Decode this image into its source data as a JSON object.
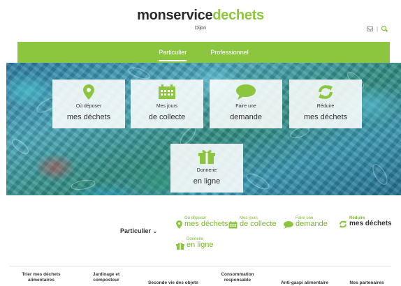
{
  "header": {
    "logo_part1": "monservice",
    "logo_part2": "dechets",
    "city": "Dijon",
    "separator": "|"
  },
  "nav": {
    "tabs": [
      {
        "label": "Particulier",
        "active": true
      },
      {
        "label": "Professionnel",
        "active": false
      }
    ]
  },
  "hero": {
    "tiles": [
      {
        "line1": "Où déposer",
        "line2": "mes déchets",
        "icon": "map-pin-icon"
      },
      {
        "line1": "Mes jours",
        "line2": "de collecte",
        "icon": "calendar-icon"
      },
      {
        "line1": "Faire une",
        "line2": "demande",
        "icon": "chat-bubble-icon"
      },
      {
        "line1": "Réduire",
        "line2": "mes déchets",
        "icon": "recycle-icon"
      },
      {
        "line1": "Donnerie",
        "line2": "en ligne",
        "icon": "gift-icon"
      }
    ]
  },
  "subnav": {
    "selector": "Particulier",
    "items": [
      {
        "line1": "Où déposer",
        "line2": "mes déchets",
        "icon": "map-pin-icon"
      },
      {
        "line1": "Mes jours",
        "line2": "de collecte",
        "icon": "calendar-icon"
      },
      {
        "line1": "Faire une",
        "line2": "demande",
        "icon": "chat-bubble-icon"
      },
      {
        "line1": "Réduire",
        "line2": "mes déchets",
        "icon": "recycle-icon"
      },
      {
        "line1": "Donnerie",
        "line2": "en ligne",
        "icon": "gift-icon"
      }
    ]
  },
  "bottom_menu": {
    "items": [
      {
        "line1": "Trier mes déchets",
        "line2": "alimentaires"
      },
      {
        "line1": "Jardinage et",
        "line2": "composteur"
      },
      {
        "line1": "Seconde vie des objets",
        "line2": ""
      },
      {
        "line1": "Consommation",
        "line2": "responsable"
      },
      {
        "line1": "Anti-gaspi alimentaire",
        "line2": ""
      },
      {
        "line1": "Nos partenaires",
        "line2": ""
      }
    ]
  },
  "colors": {
    "brand_green": "#8cc63f",
    "text_dark": "#2b2b2b"
  }
}
